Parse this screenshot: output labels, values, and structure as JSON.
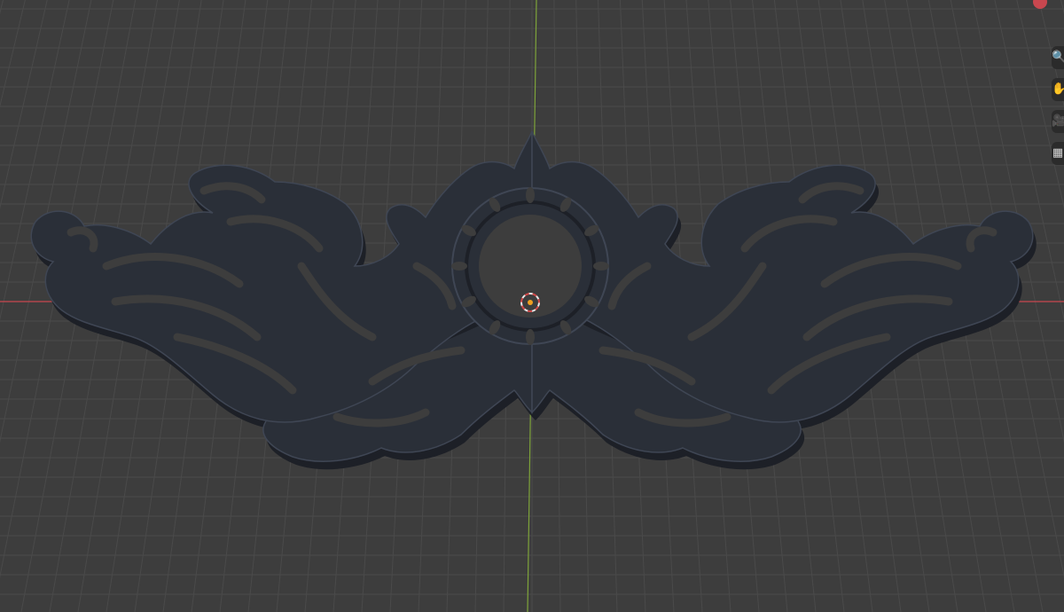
{
  "viewport": {
    "name": "3D Viewport",
    "background": "#3d3d3d",
    "grid_color": "#4a4a4a",
    "x_axis_color": "#c8474f",
    "y_axis_color": "#7ea43a",
    "object_color": "#2a2f38",
    "object_shadow": "#1d2027",
    "object_edge": "#3f4654"
  },
  "gizmo": {
    "x_axis_color": "#c8474f",
    "y_axis_color": "#86b33d",
    "z_axis_color": "#4a74c2"
  },
  "side_tools": [
    {
      "icon": "zoom-icon"
    },
    {
      "icon": "hand-pan-icon"
    },
    {
      "icon": "camera-icon"
    },
    {
      "icon": "grid-toggle-icon"
    }
  ]
}
